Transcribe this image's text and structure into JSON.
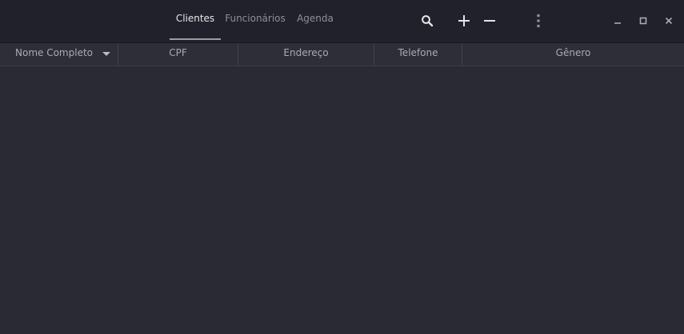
{
  "tabs": [
    {
      "label": "Clientes",
      "active": true
    },
    {
      "label": "Funcionários",
      "active": false
    },
    {
      "label": "Agenda",
      "active": false
    }
  ],
  "header_buttons": {
    "search": "search-icon",
    "add": "plus-icon",
    "remove": "minus-icon",
    "menu": "vertical-dots-icon"
  },
  "window_controls": {
    "minimize": "minimize-icon",
    "maximize": "maximize-icon",
    "close": "close-icon"
  },
  "table": {
    "columns": [
      "Nome Completo",
      "CPF",
      "Endereço",
      "Telefone",
      "Gênero"
    ],
    "sort_column": "Nome Completo",
    "sort_direction": "descending",
    "rows": []
  },
  "colors": {
    "background": "#292a34",
    "headerbar": "#20212a",
    "column_header": "#2d2e38",
    "active_tab": "#e6e7ea",
    "inactive_tab": "#8e9099"
  }
}
